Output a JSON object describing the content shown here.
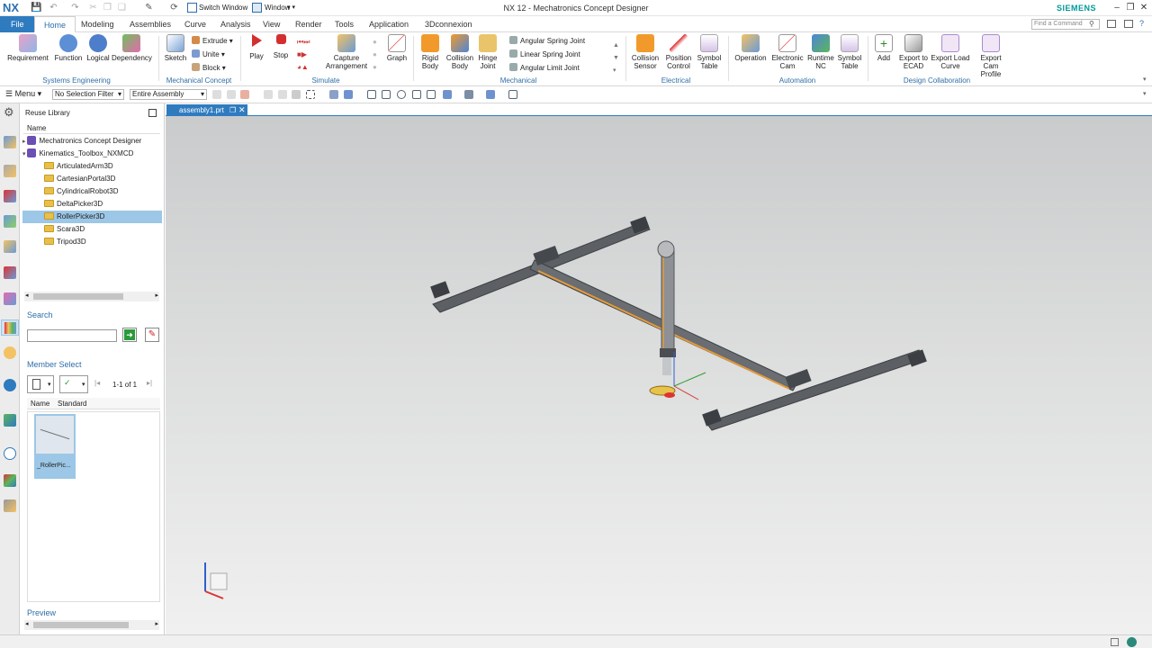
{
  "titlebar": {
    "logo": "NX",
    "switch_window": "Switch Window",
    "window_menu": "Window",
    "title": "NX 12 - Mechatronics Concept Designer",
    "brand": "SIEMENS"
  },
  "tabs": [
    "File",
    "Home",
    "Modeling",
    "Assemblies",
    "Curve",
    "Analysis",
    "View",
    "Render",
    "Tools",
    "Application",
    "3Dconnexion"
  ],
  "command_finder": {
    "placeholder": "Find a Command"
  },
  "ribbon": {
    "systems_engineering": {
      "label": "Systems Engineering",
      "buttons": [
        "Requirement",
        "Function",
        "Logical",
        "Dependency"
      ]
    },
    "mechanical_concept": {
      "label": "Mechanical Concept",
      "sketch": "Sketch",
      "extrude": "Extrude",
      "unite": "Unite",
      "block": "Block"
    },
    "simulate": {
      "label": "Simulate",
      "play": "Play",
      "stop": "Stop",
      "capture_1": "Capture",
      "capture_2": "Arrangement",
      "graph": "Graph"
    },
    "mechanical": {
      "label": "Mechanical",
      "rigid_1": "Rigid",
      "rigid_2": "Body",
      "collision_1": "Collision",
      "collision_2": "Body",
      "hinge_1": "Hinge",
      "hinge_2": "Joint",
      "angular_spring": "Angular Spring Joint",
      "linear_spring": "Linear Spring Joint",
      "angular_limit": "Angular Limit Joint"
    },
    "electrical": {
      "label": "Electrical",
      "collision_sensor_1": "Collision",
      "collision_sensor_2": "Sensor",
      "position_control_1": "Position",
      "position_control_2": "Control",
      "symbol_table_1": "Symbol",
      "symbol_table_2": "Table"
    },
    "automation": {
      "label": "Automation",
      "operation": "Operation",
      "ecam_1": "Electronic",
      "ecam_2": "Cam",
      "runtime_1": "Runtime",
      "runtime_2": "NC",
      "symbol_1": "Symbol",
      "symbol_2": "Table"
    },
    "design_collab": {
      "label": "Design Collaboration",
      "add": "Add",
      "ecad_1": "Export to",
      "ecad_2": "ECAD",
      "load_1": "Export Load",
      "load_2": "Curve",
      "cam_1": "Export Cam",
      "cam_2": "Profile"
    }
  },
  "toolbar2": {
    "menu": "Menu",
    "selection_filter": "No Selection Filter",
    "scope": "Entire Assembly"
  },
  "panel": {
    "title": "Reuse Library",
    "column_name": "Name",
    "tree": [
      {
        "label": "Mechatronics Concept Designer",
        "kind": "library"
      },
      {
        "label": "Kinematics_Toolbox_NXMCD",
        "kind": "library"
      },
      {
        "label": "ArticulatedArm3D",
        "kind": "folder"
      },
      {
        "label": "CartesianPortal3D",
        "kind": "folder"
      },
      {
        "label": "CylindricalRobot3D",
        "kind": "folder"
      },
      {
        "label": "DeltaPicker3D",
        "kind": "folder"
      },
      {
        "label": "RollerPicker3D",
        "kind": "folder",
        "selected": true
      },
      {
        "label": "Scara3D",
        "kind": "folder"
      },
      {
        "label": "Tripod3D",
        "kind": "folder"
      }
    ],
    "search_title": "Search",
    "member_select_title": "Member Select",
    "pager": "1-1 of 1",
    "member_columns": [
      "Name",
      "Standard"
    ],
    "member_item": "_RollerPic...",
    "preview_title": "Preview"
  },
  "document": {
    "tab": "assembly1.prt"
  },
  "colors": {
    "accent": "#2f7bbf",
    "selection": "#9cc7e6",
    "brand": "#009999"
  }
}
